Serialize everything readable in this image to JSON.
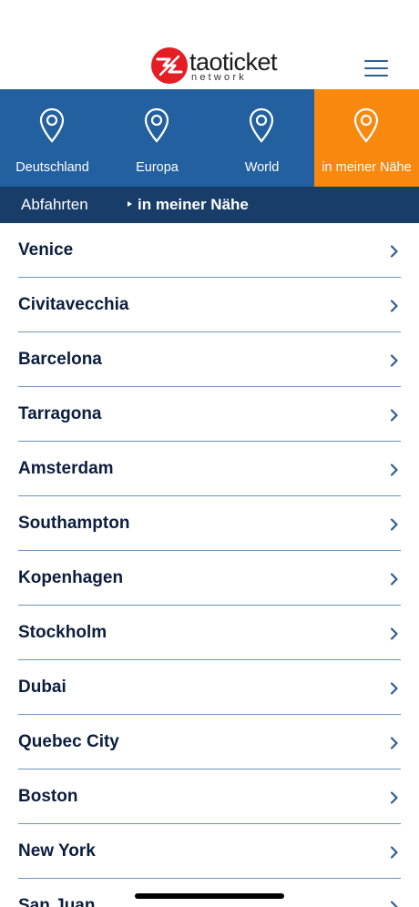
{
  "header": {
    "logo_text": "taoticket",
    "logo_sub": "network",
    "menu_icon": "hamburger-menu-icon"
  },
  "nav": {
    "tabs": [
      {
        "label": "Deutschland",
        "icon": "location-pin-icon",
        "active": false
      },
      {
        "label": "Europa",
        "icon": "location-pin-icon",
        "active": false
      },
      {
        "label": "World",
        "icon": "location-pin-icon",
        "active": false
      },
      {
        "label": "in meiner Nähe",
        "icon": "location-pin-icon",
        "active": true
      }
    ]
  },
  "breadcrumb": {
    "home": "Abfahrten",
    "current": "in meiner Nähe"
  },
  "cities": [
    {
      "label": "Venice"
    },
    {
      "label": "Civitavecchia"
    },
    {
      "label": "Barcelona"
    },
    {
      "label": "Tarragona"
    },
    {
      "label": "Amsterdam"
    },
    {
      "label": "Southampton"
    },
    {
      "label": "Kopenhagen"
    },
    {
      "label": "Stockholm"
    },
    {
      "label": "Dubai"
    },
    {
      "label": "Quebec City"
    },
    {
      "label": "Boston"
    },
    {
      "label": "New York"
    },
    {
      "label": "San Juan"
    }
  ],
  "colors": {
    "nav_blue": "#23609f",
    "nav_active": "#f8890e",
    "breadcrumb_bg": "#173d68",
    "text_dark": "#0c1e3e",
    "divider": "#6d93bd",
    "logo_red": "#e31e24"
  }
}
